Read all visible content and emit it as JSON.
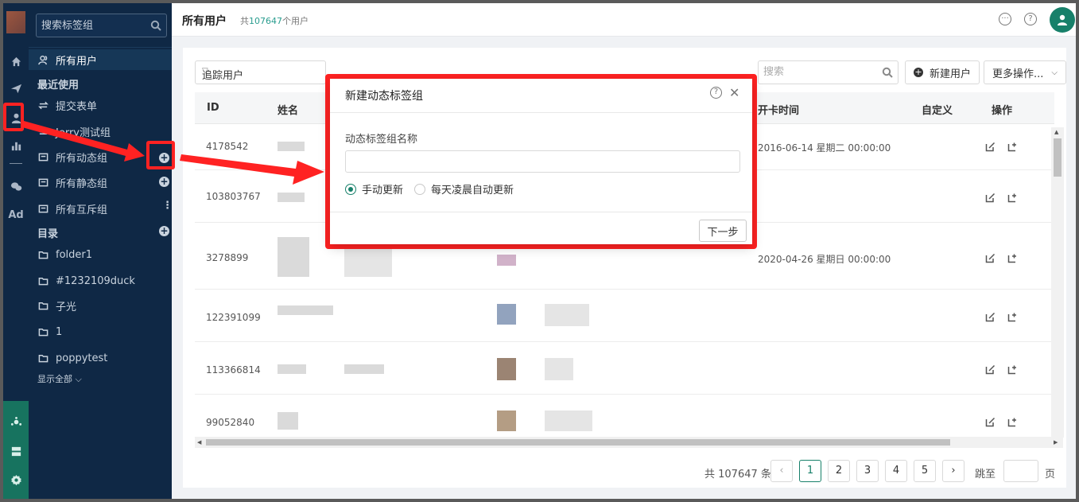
{
  "header": {
    "title": "所有用户",
    "count_prefix": "共",
    "count_value": "107647",
    "count_suffix": "个用户"
  },
  "rail": {
    "items": [
      "home-icon",
      "send-icon",
      "user-icon",
      "chart-icon",
      "wechat-icon",
      "Ad"
    ],
    "ad_label": "Ad"
  },
  "sidebar": {
    "search_placeholder": "搜索标签组",
    "all_users": "所有用户",
    "recent_heading": "最近使用",
    "recent_items": [
      "提交表单",
      "Jerry测试组"
    ],
    "dynamic_group": "所有动态组",
    "static_group": "所有静态组",
    "exclusive_group": "所有互斥组",
    "directory_heading": "目录",
    "folders": [
      "folder1",
      "#1232109duck",
      "子光",
      "1",
      "poppytest"
    ],
    "show_all": "显示全部"
  },
  "toolbar": {
    "filter_value": "追踪用户",
    "search_placeholder": "搜索",
    "new_user_label": "新建用户",
    "more_actions_label": "更多操作..."
  },
  "table": {
    "columns": [
      "ID",
      "姓名",
      "开卡时间",
      "自定义",
      "操作"
    ],
    "rows": [
      {
        "id": "4178542",
        "open_time": "2016-06-14 星期二 00:00:00"
      },
      {
        "id": "103803767",
        "open_time": ""
      },
      {
        "id": "3278899",
        "open_time": "2020-04-26 星期日 00:00:00"
      },
      {
        "id": "122391099",
        "open_time": ""
      },
      {
        "id": "113366814",
        "open_time": ""
      },
      {
        "id": "99052840",
        "open_time": ""
      }
    ]
  },
  "pagination": {
    "total": "共 107647 条",
    "pages": [
      "1",
      "2",
      "3",
      "4",
      "5"
    ],
    "current": "1",
    "goto_label": "跳至",
    "page_suffix": "页"
  },
  "modal": {
    "title": "新建动态标签组",
    "field_label": "动态标签组名称",
    "field_value": "",
    "options": [
      "手动更新",
      "每天凌晨自动更新"
    ],
    "selected_option": "手动更新",
    "next_label": "下一步"
  },
  "colors": {
    "sidebar_bg": "#0f2845",
    "accent": "#17806a",
    "annotation": "#ff2222"
  }
}
